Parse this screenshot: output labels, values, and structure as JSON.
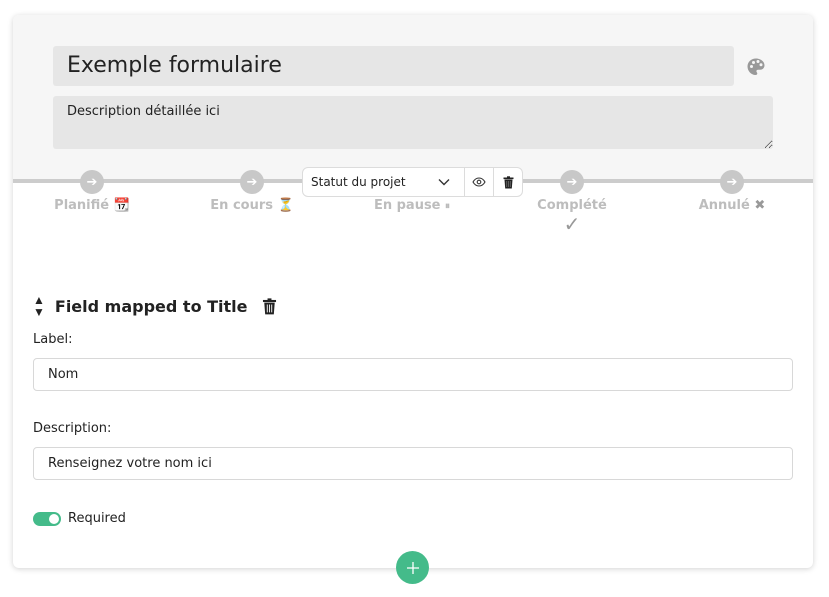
{
  "form": {
    "title": "Exemple formulaire",
    "description": "Description détaillée ici",
    "theme_icon": "palette-icon"
  },
  "status": {
    "select_label": "Statut du projet",
    "steps": [
      {
        "label": "Planifié",
        "suffix": "📆"
      },
      {
        "label": "En cours",
        "suffix": "⏳"
      },
      {
        "label": "En pause",
        "suffix": "⏸"
      },
      {
        "label": "Complété",
        "suffix": "✓"
      },
      {
        "label": "Annulé",
        "suffix": "✖"
      }
    ],
    "step_icon": "arrow-right-icon",
    "toolbar_icons": [
      "chevron-down-icon",
      "eye-icon",
      "trash-icon"
    ]
  },
  "field": {
    "heading": "Field mapped to Title",
    "label_caption": "Label:",
    "label_value": "Nom",
    "description_caption": "Description:",
    "description_value": "Renseignez votre nom ici",
    "required_label": "Required",
    "required": true
  },
  "colors": {
    "accent": "#44bb8a",
    "header_bg": "#f6f6f6",
    "input_bg": "#e6e6e6",
    "step_gray": "#c8c8c8"
  }
}
